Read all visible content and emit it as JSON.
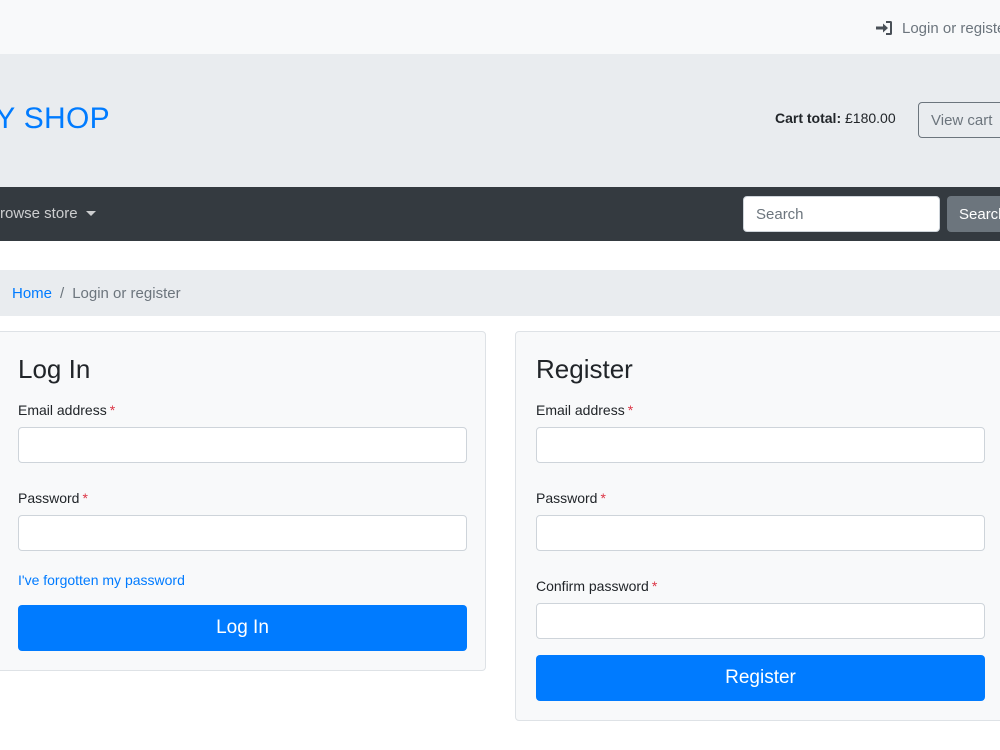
{
  "topbar": {
    "login_link": "Login or register"
  },
  "header": {
    "brand": "MY SHOP",
    "cart_total_label": "Cart total:",
    "cart_total_value": "£180.00",
    "view_cart_label": "View cart"
  },
  "navbar": {
    "browse_label": "Browse store",
    "search_placeholder": "Search",
    "search_button": "Search"
  },
  "breadcrumb": {
    "home": "Home",
    "separator": "/",
    "current": "Login or register"
  },
  "login": {
    "title": "Log In",
    "email_label": "Email address",
    "password_label": "Password",
    "required_mark": "*",
    "forgot_link": "I've forgotten my password",
    "submit": "Log In"
  },
  "register": {
    "title": "Register",
    "email_label": "Email address",
    "password_label": "Password",
    "confirm_label": "Confirm password",
    "required_mark": "*",
    "submit": "Register"
  },
  "colors": {
    "primary": "#007bff",
    "navbar": "#343a40",
    "header_bg": "#e9ecef",
    "required": "#dc3545"
  }
}
